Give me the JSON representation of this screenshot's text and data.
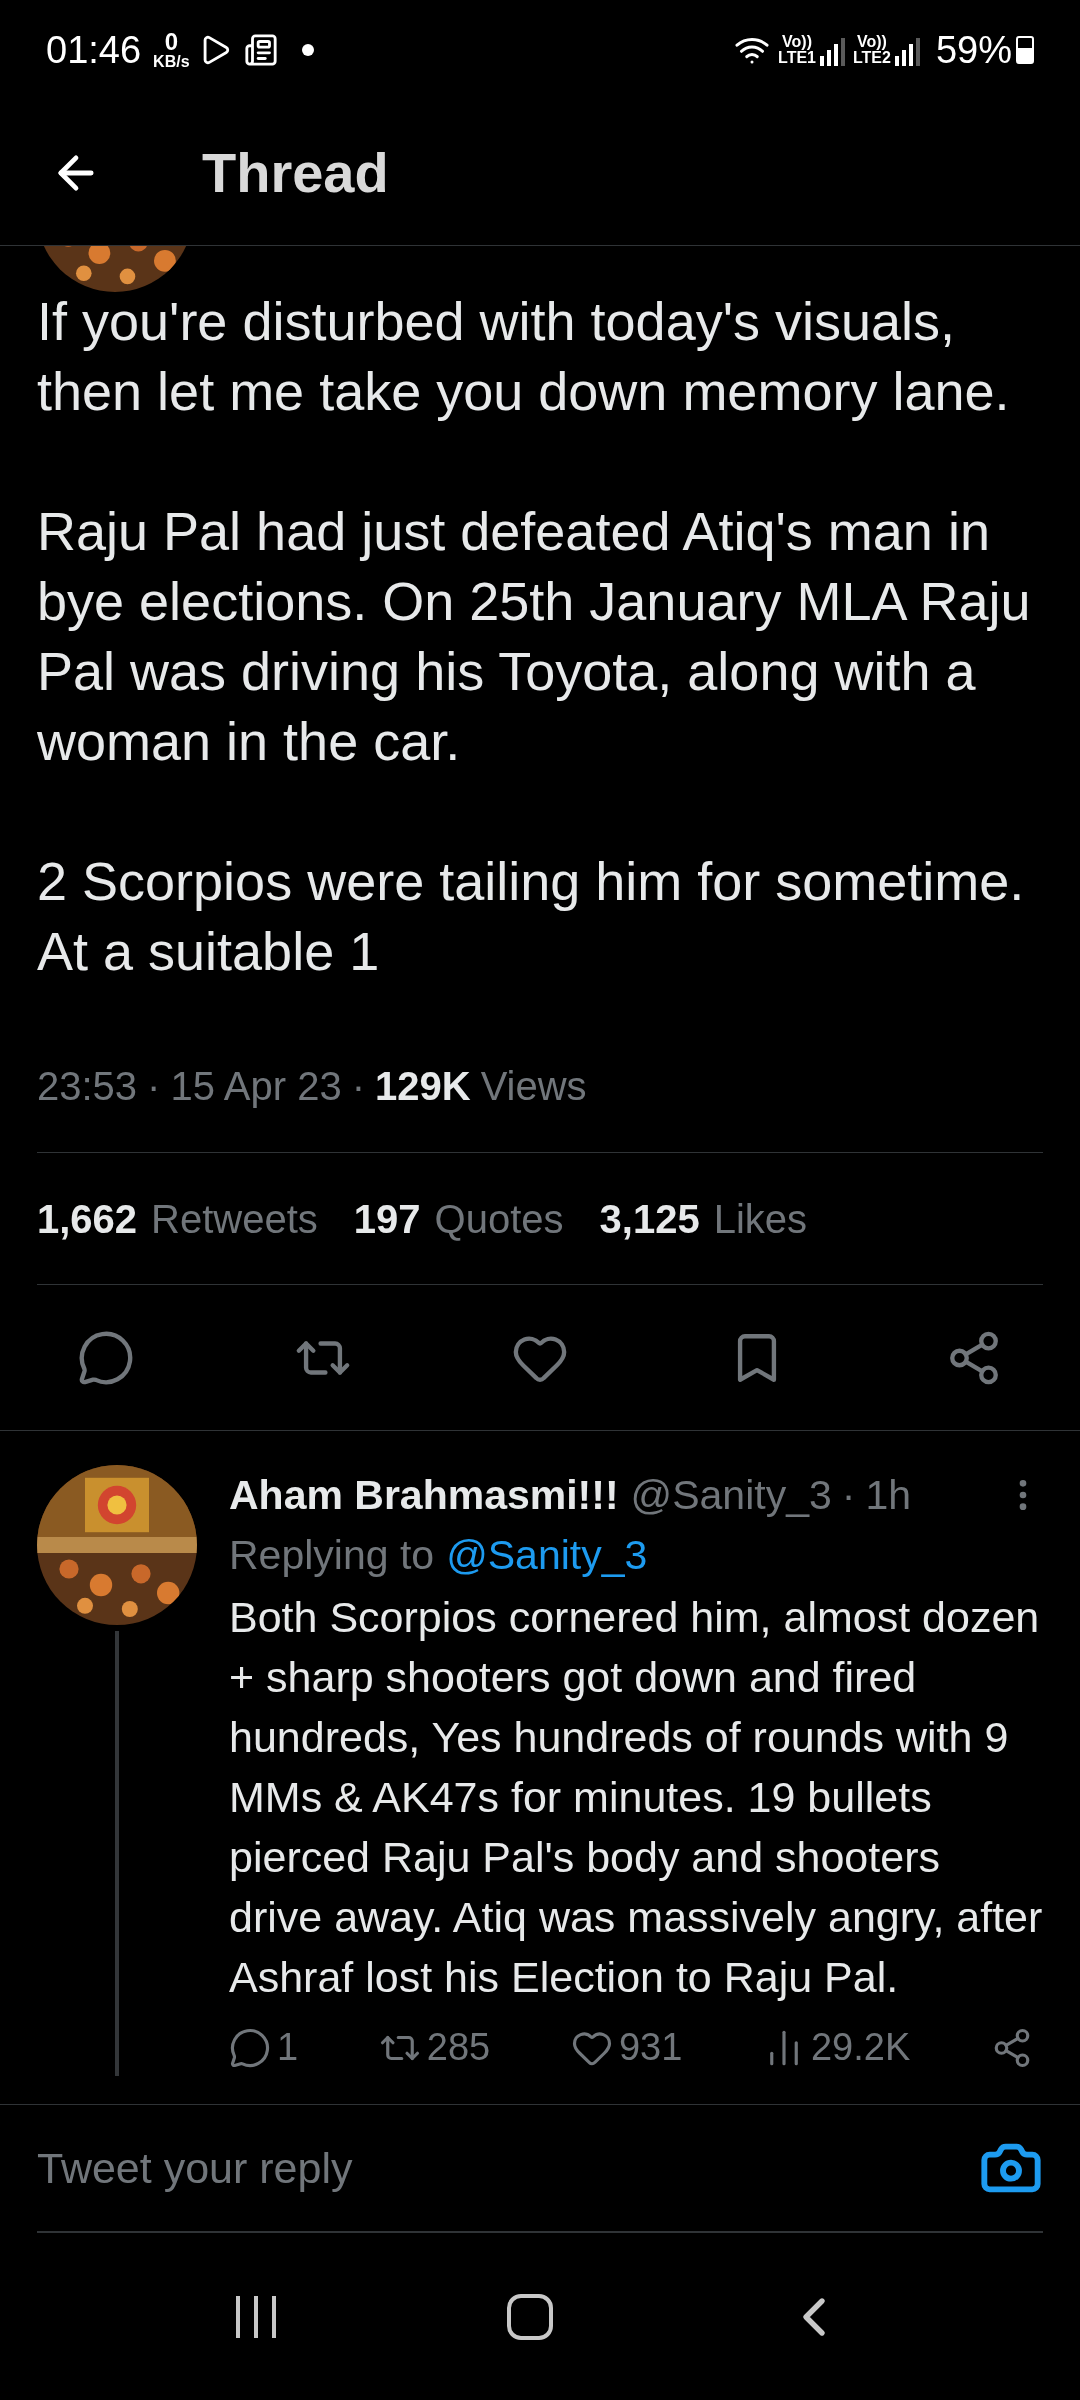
{
  "status_bar": {
    "time": "01:46",
    "net_speed": "0",
    "net_unit": "KB/s",
    "battery": "59%",
    "sims": [
      {
        "volte": "Vo))",
        "lte": "LTE1"
      },
      {
        "volte": "Vo))",
        "lte": "LTE2"
      }
    ]
  },
  "header": {
    "title": "Thread"
  },
  "tweet": {
    "paragraphs": [
      "If you're disturbed with today's visuals, then let me take you down memory lane.",
      "Raju Pal had just defeated Atiq's man in bye elections. On 25th January MLA Raju Pal was driving his Toyota, along with a woman in the car.",
      "2 Scorpios were tailing him for sometime. At a suitable 1"
    ],
    "time": "23:53",
    "sep": "·",
    "date": "15 Apr 23",
    "views_count": "129K",
    "views_label": "Views",
    "stats": [
      {
        "count": "1,662",
        "label": "Retweets"
      },
      {
        "count": "197",
        "label": "Quotes"
      },
      {
        "count": "3,125",
        "label": "Likes"
      }
    ],
    "actions": [
      {
        "kind": "reply"
      },
      {
        "kind": "retweet"
      },
      {
        "kind": "like"
      },
      {
        "kind": "bookmark"
      },
      {
        "kind": "share"
      }
    ]
  },
  "reply": {
    "name": "Aham Brahmasmi!!!",
    "handle": "@Sanity_3",
    "sep": "·",
    "time": "1h",
    "replying_label": "Replying to",
    "replying_to": "@Sanity_3",
    "text": "Both Scorpios cornered him, almost dozen + sharp shooters got down and fired hundreds, Yes hundreds of rounds with 9 MMs & AK47s for minutes. 19 bullets pierced Raju Pal's body and shooters drive away. Atiq was massively angry, after Ashraf lost his Election to Raju Pal.",
    "actions": [
      {
        "kind": "reply",
        "count": "1"
      },
      {
        "kind": "retweet",
        "count": "285"
      },
      {
        "kind": "like",
        "count": "931"
      },
      {
        "kind": "views",
        "count": "29.2K"
      },
      {
        "kind": "share"
      }
    ]
  },
  "composer": {
    "placeholder": "Tweet your reply"
  }
}
